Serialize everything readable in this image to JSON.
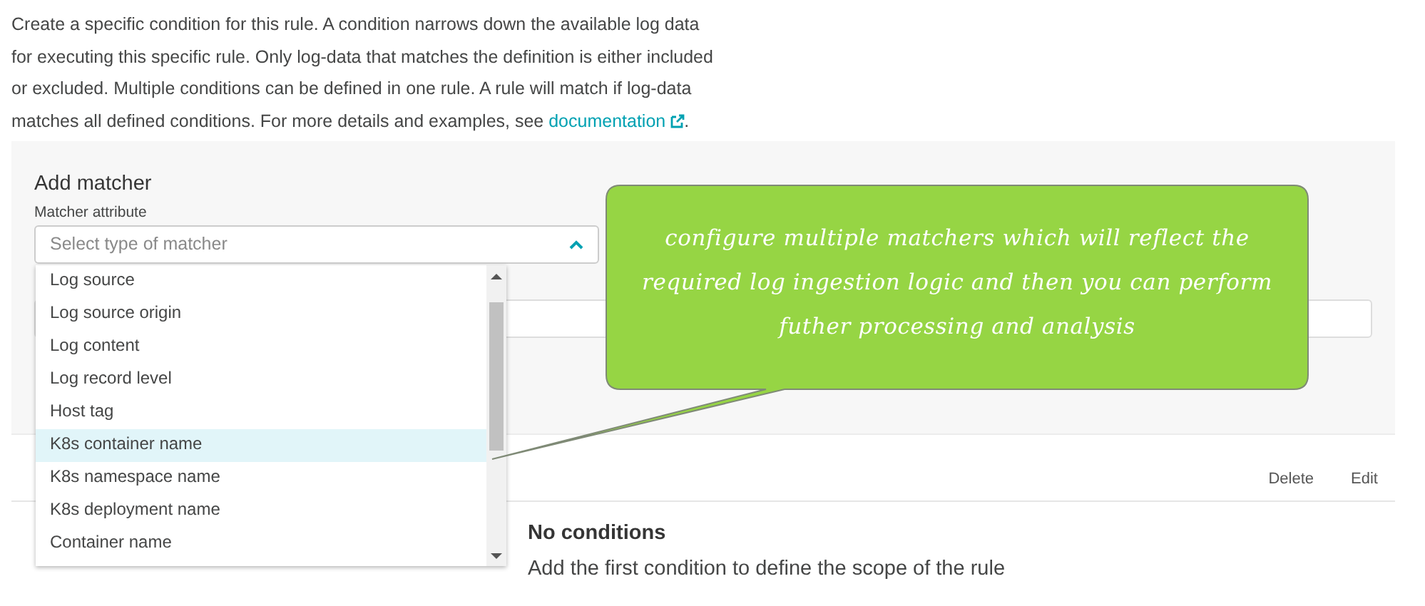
{
  "intro": {
    "text": "Create a specific condition for this rule. A condition narrows down the available log data for executing this specific rule. Only log-data that matches the definition is either included or excluded. Multiple conditions can be defined in one rule. A rule will match if log-data matches all defined conditions. For more details and examples, see ",
    "link": "documentation",
    "after": "."
  },
  "matcher_panel": {
    "title": "Add matcher",
    "field_label": "Matcher attribute",
    "placeholder": "Select type of matcher",
    "expanded": true
  },
  "dropdown_options": [
    {
      "label": "Log source",
      "selected": false
    },
    {
      "label": "Log source origin",
      "selected": false
    },
    {
      "label": "Log content",
      "selected": false
    },
    {
      "label": "Log record level",
      "selected": false
    },
    {
      "label": "Host tag",
      "selected": false
    },
    {
      "label": "K8s container name",
      "selected": true
    },
    {
      "label": "K8s namespace name",
      "selected": false
    },
    {
      "label": "K8s deployment name",
      "selected": false
    },
    {
      "label": "Container name",
      "selected": false
    }
  ],
  "conditions": {
    "actions": [
      "Delete",
      "Edit"
    ],
    "empty_title": "No conditions",
    "empty_text": "Add the first condition to define the scope of the rule"
  },
  "callout": {
    "text": "configure multiple matchers which will reflect the required log ingestion logic and then you can perform futher processing and analysis"
  }
}
